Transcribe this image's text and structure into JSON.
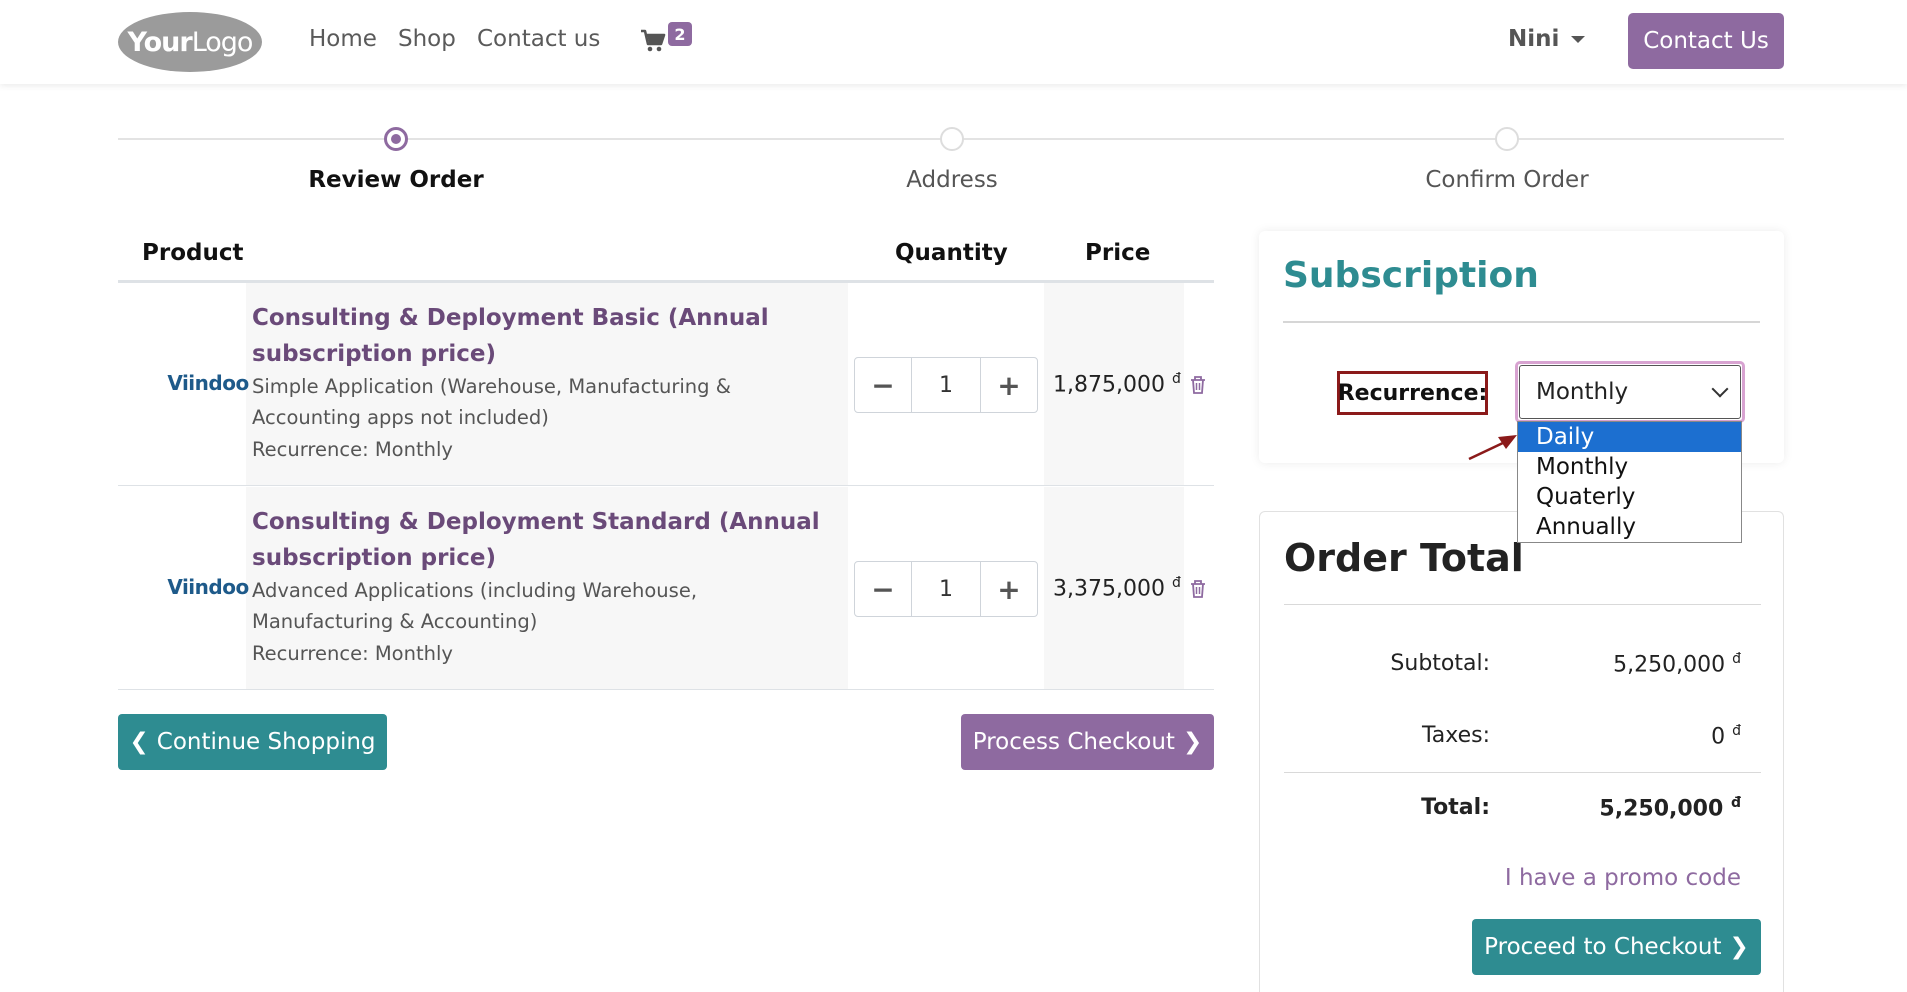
{
  "header": {
    "logo_text_bold": "Your",
    "logo_text": "Logo",
    "nav": [
      {
        "label": "Home"
      },
      {
        "label": "Shop"
      },
      {
        "label": "Contact us"
      }
    ],
    "cart_count": "2",
    "user": "Nini",
    "contact_button": "Contact Us"
  },
  "steps": [
    {
      "label": "Review Order"
    },
    {
      "label": "Address"
    },
    {
      "label": "Confirm Order"
    }
  ],
  "table": {
    "headers": {
      "product": "Product",
      "quantity": "Quantity",
      "price": "Price"
    },
    "rows": [
      {
        "brand": "Viindoo",
        "title": "Consulting & Deployment Basic (Annual subscription price)",
        "description": "Simple Application (Warehouse, Manufacturing & Accounting apps not included)",
        "recurrence": "Recurrence: Monthly",
        "quantity": "1",
        "price": "1,875,000",
        "currency": "đ"
      },
      {
        "brand": "Viindoo",
        "title": "Consulting & Deployment Standard (Annual subscription price)",
        "description": "Advanced Applications (including Warehouse, Manufacturing & Accounting)",
        "recurrence": "Recurrence: Monthly",
        "quantity": "1",
        "price": "3,375,000",
        "currency": "đ"
      }
    ]
  },
  "buttons": {
    "continue_shopping": "Continue Shopping",
    "process_checkout": "Process Checkout",
    "proceed_checkout": "Proceed to Checkout"
  },
  "subscription": {
    "title": "Subscription",
    "recurrence_label": "Recurrence:",
    "selected": "Monthly",
    "options": [
      "Daily",
      "Monthly",
      "Quaterly",
      "Annually"
    ],
    "highlighted_option": "Daily"
  },
  "order_total": {
    "title": "Order Total",
    "subtotal_label": "Subtotal:",
    "subtotal": "5,250,000",
    "taxes_label": "Taxes:",
    "taxes": "0",
    "total_label": "Total:",
    "total": "5,250,000",
    "currency": "đ",
    "promo": "I have a promo code"
  },
  "colors": {
    "primary": "#8e6aa0",
    "secondary": "#2e8c91",
    "highlight_border": "#8b1a1a"
  }
}
